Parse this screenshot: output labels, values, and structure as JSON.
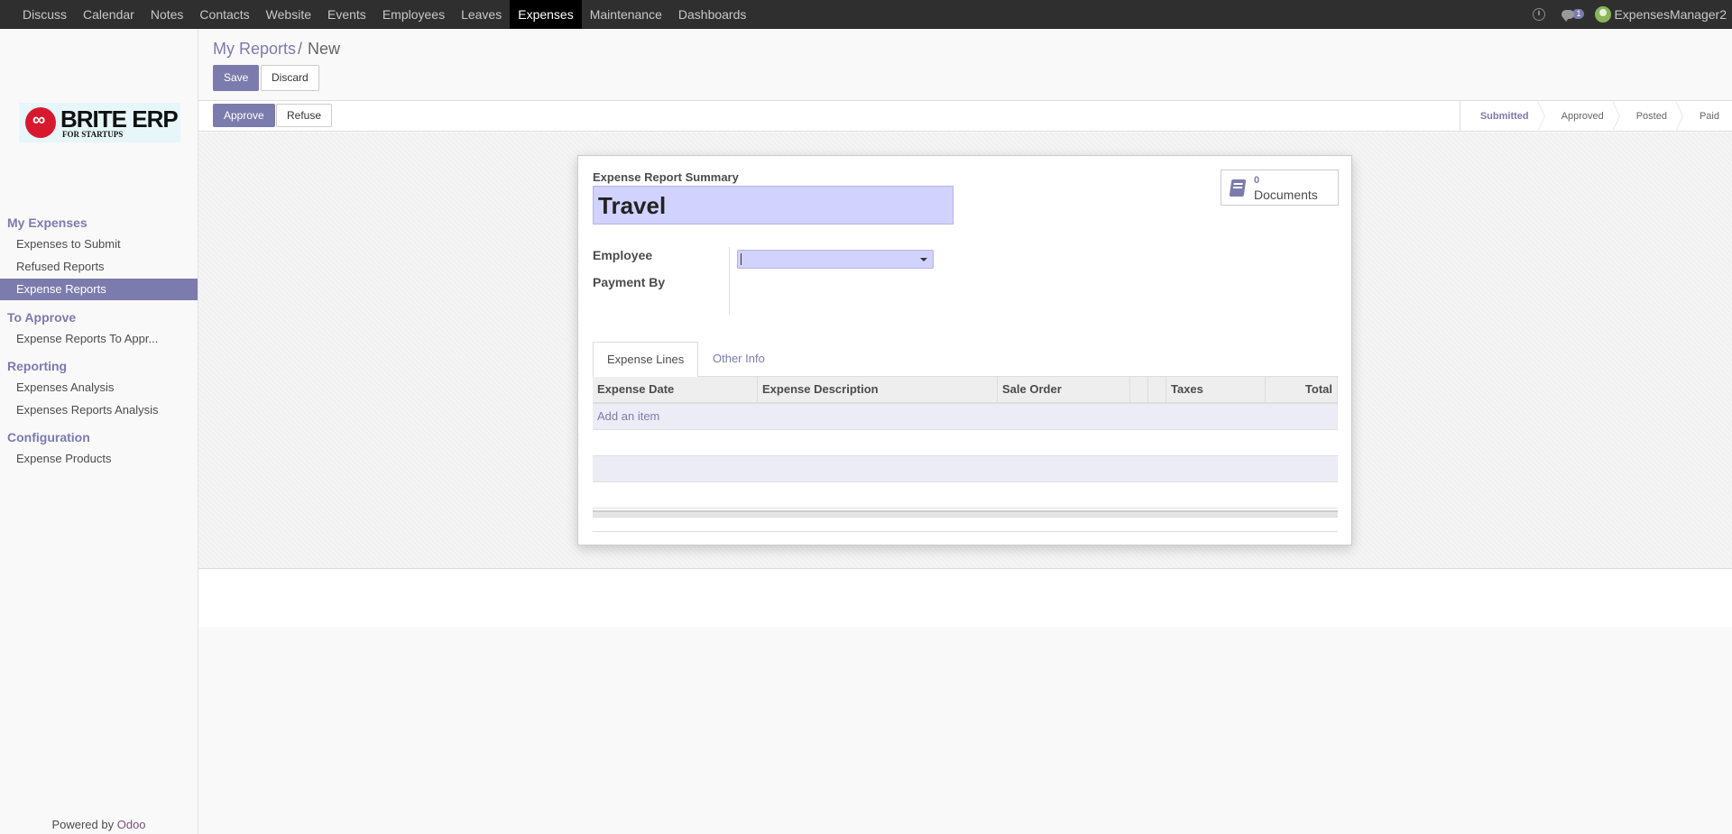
{
  "topbar": {
    "apps": [
      "Discuss",
      "Calendar",
      "Notes",
      "Contacts",
      "Website",
      "Events",
      "Employees",
      "Leaves",
      "Expenses",
      "Maintenance",
      "Dashboards"
    ],
    "active_app": "Expenses",
    "message_count": "1",
    "username": "ExpensesManager2"
  },
  "logo": {
    "name": "BRITE ERP",
    "tagline": "FOR STARTUPS"
  },
  "sidebar": {
    "sections": [
      {
        "title": "My Expenses",
        "items": [
          "Expenses to Submit",
          "Refused Reports",
          "Expense Reports"
        ]
      },
      {
        "title": "To Approve",
        "items": [
          "Expense Reports To Appr..."
        ]
      },
      {
        "title": "Reporting",
        "items": [
          "Expenses Analysis",
          "Expenses Reports Analysis"
        ]
      },
      {
        "title": "Configuration",
        "items": [
          "Expense Products"
        ]
      }
    ],
    "active_item": "Expense Reports",
    "powered_by": "Powered by",
    "powered_brand": "Odoo"
  },
  "breadcrumb": {
    "parent": "My Reports",
    "separator": "/",
    "current": "New"
  },
  "buttons": {
    "save": "Save",
    "discard": "Discard",
    "approve": "Approve",
    "refuse": "Refuse"
  },
  "stages": [
    "Submitted",
    "Approved",
    "Posted",
    "Paid"
  ],
  "current_stage": "Submitted",
  "form": {
    "summary_label": "Expense Report Summary",
    "summary_value": "Travel",
    "documents_count": "0",
    "documents_label": "Documents",
    "employee_label": "Employee",
    "employee_value": "",
    "payment_label": "Payment By"
  },
  "tabs": [
    "Expense Lines",
    "Other Info"
  ],
  "active_tab": "Expense Lines",
  "table": {
    "columns": [
      "Expense Date",
      "Expense Description",
      "Sale Order",
      "",
      "",
      "Taxes",
      "Total"
    ],
    "add_item": "Add an item"
  },
  "colors": {
    "accent": "#7c7bad",
    "topbar": "#2f2f2f",
    "input_bg": "#d2d2ff"
  }
}
